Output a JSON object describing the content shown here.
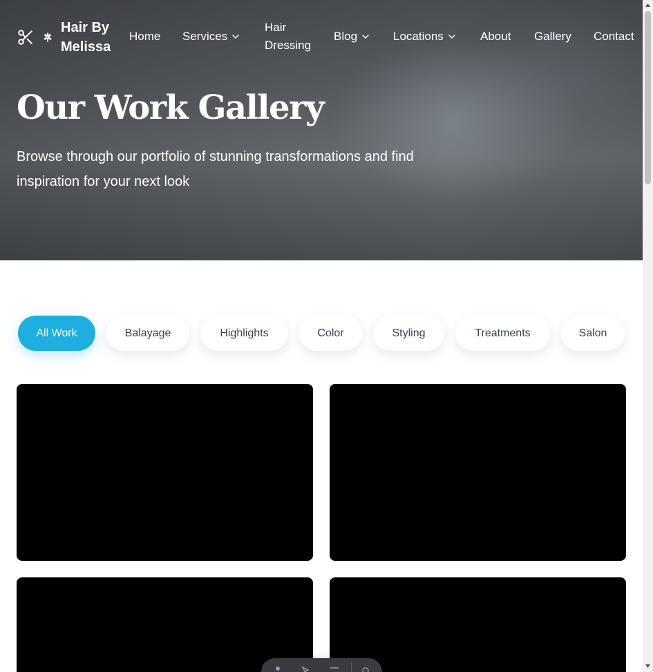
{
  "brand": {
    "name": "Hair By Melissa",
    "icon": "scissors-icon",
    "secondary_icon": "flower-icon"
  },
  "nav": {
    "items": [
      {
        "label": "Home",
        "has_dropdown": false
      },
      {
        "label": "Services",
        "has_dropdown": true
      },
      {
        "label": "Hair Dressing",
        "has_dropdown": false
      },
      {
        "label": "Blog",
        "has_dropdown": true
      },
      {
        "label": "Locations",
        "has_dropdown": true
      },
      {
        "label": "About",
        "has_dropdown": false
      },
      {
        "label": "Gallery",
        "has_dropdown": false
      },
      {
        "label": "Contact",
        "has_dropdown": false
      }
    ]
  },
  "hero": {
    "title": "Our Work Gallery",
    "subtitle": "Browse through our portfolio of stunning transformations and find inspiration for your next look"
  },
  "filters": {
    "active": "All Work",
    "items": [
      "All Work",
      "Balayage",
      "Highlights",
      "Color",
      "Styling",
      "Treatments",
      "Salon"
    ]
  },
  "gallery": {
    "tiles_visible": 4
  },
  "colors": {
    "accent": "#1eaee0",
    "pill_text": "#374151",
    "tile": "#000000"
  }
}
